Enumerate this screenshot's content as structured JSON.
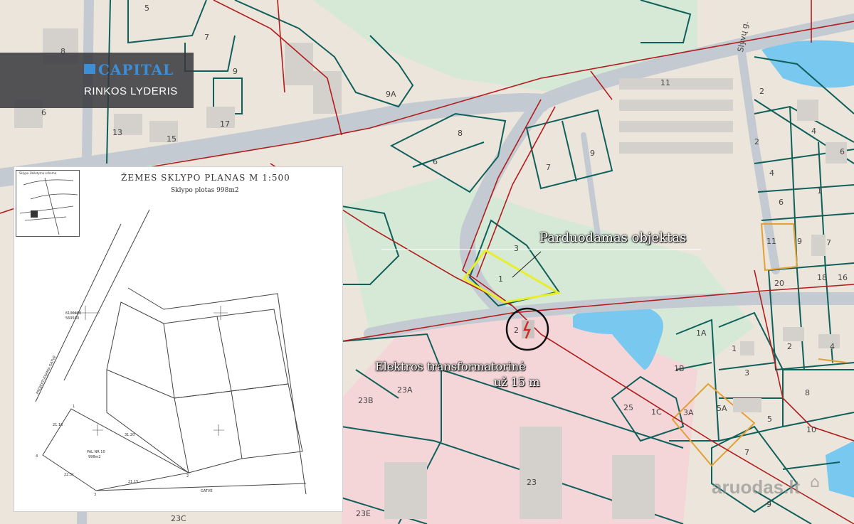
{
  "logo": {
    "brand": "CAPITAL",
    "tagline": "RINKOS LYDERIS"
  },
  "plan": {
    "title": "ŽEMES   SKLYPO   PLANAS   M 1:500",
    "area": "Sklypo   plotas 998m2",
    "inset_title": "Sklypo išdėstymo schema",
    "coord1": "6100400",
    "coord2": "569500",
    "street_left": "PROJEKTUOJAMA GATVĖ",
    "street_bottom": "GATVĖ",
    "parcel_label": "PAL NR 10",
    "parcel_area": "998m2",
    "dim1": "21.16",
    "dim2": "22.51",
    "dim3": "21.15",
    "dim4": "31.20",
    "pt1": "1",
    "pt2": "2",
    "pt3": "3",
    "pt4": "4"
  },
  "annotations": {
    "parcel": "Parduodamas objektas",
    "transformer_line1": "Elektros transformatorinė",
    "transformer_line2": "už 15 m"
  },
  "map_labels": [
    "5",
    "7",
    "8",
    "9",
    "6",
    "13",
    "15",
    "17",
    "9A",
    "11",
    "8",
    "6",
    "7",
    "9",
    "3",
    "1",
    "2",
    "23A",
    "23B",
    "23",
    "23E",
    "23C",
    "1A",
    "1B",
    "1C",
    "25",
    "3A",
    "5A",
    "7",
    "5",
    "10",
    "8",
    "3",
    "1",
    "2",
    "4",
    "18",
    "16",
    "20",
    "11",
    "9",
    "7",
    "6",
    "4",
    "1",
    "2",
    "4",
    "6",
    "2",
    "9",
    "11"
  ],
  "street": "Slyvų g.",
  "watermark": "aruodas.lt",
  "colors": {
    "parcel_border": "#0f5f5b",
    "highlight": "#e8ef2a",
    "power_line": "#b11d1d",
    "road": "#c4cad2",
    "green": "#cfe6d4",
    "water": "#79c8ef",
    "industrial": "#f4d3d5",
    "orange": "#e3a135"
  }
}
